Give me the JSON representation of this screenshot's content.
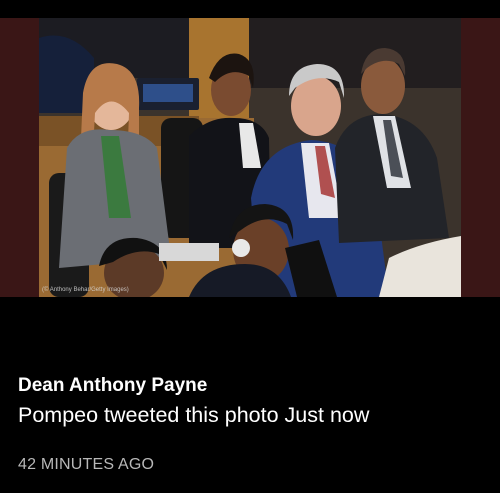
{
  "photo": {
    "credit": "(© Anthony Behar/Getty Images)"
  },
  "post": {
    "author": "Dean Anthony Payne",
    "headline": "Pompeo tweeted this photo Just now",
    "timestamp": "42 MINUTES AGO"
  },
  "colors": {
    "background": "#000000",
    "photo_band": "#3a1616",
    "text_primary": "#ffffff",
    "text_secondary": "#b8b8b8"
  }
}
